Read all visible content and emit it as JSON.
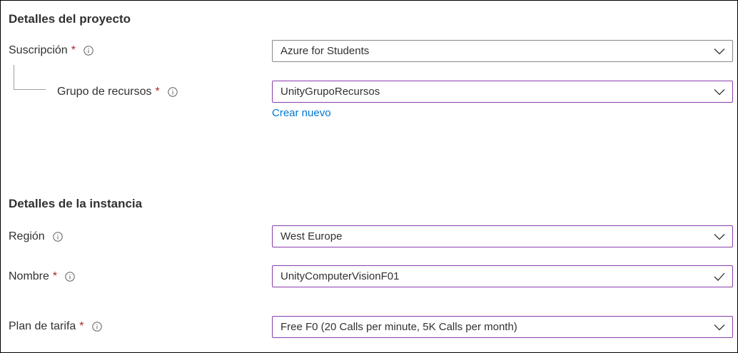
{
  "project": {
    "title": "Detalles del proyecto",
    "subscription": {
      "label": "Suscripción",
      "required": "*",
      "value": "Azure for Students"
    },
    "resource_group": {
      "label": "Grupo de recursos",
      "required": "*",
      "value": "UnityGrupoRecursos",
      "create_new": "Crear nuevo"
    }
  },
  "instance": {
    "title": "Detalles de la instancia",
    "region": {
      "label": "Región",
      "value": "West Europe"
    },
    "name": {
      "label": "Nombre",
      "required": "*",
      "value": "UnityComputerVisionF01"
    },
    "pricing": {
      "label": "Plan de tarifa",
      "required": "*",
      "value": "Free F0 (20 Calls per minute, 5K Calls per month)"
    }
  },
  "colors": {
    "required": "#a4262c",
    "link": "#0078d4",
    "focus_border": "#8a3ea8",
    "default_border": "#8a8886"
  },
  "icons": {
    "info": "info-icon",
    "dropdown": "chevron-down-icon",
    "valid": "checkmark-icon"
  }
}
